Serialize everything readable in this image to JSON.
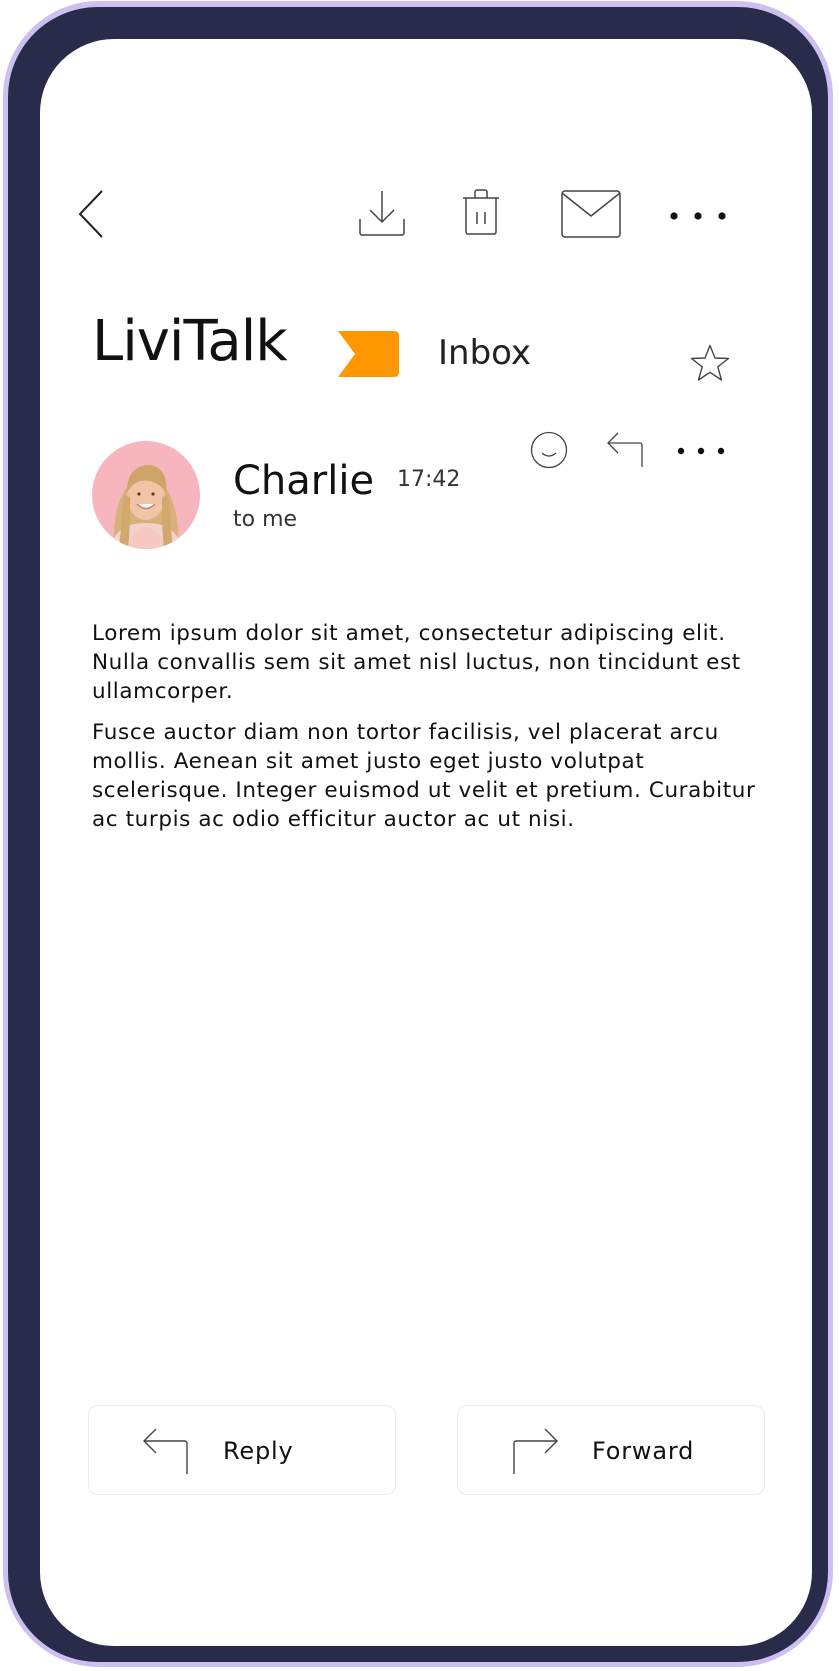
{
  "toolbar": {
    "back_icon": "chevron-left-icon",
    "download_icon": "download-icon",
    "delete_icon": "trash-icon",
    "mail_icon": "envelope-icon",
    "more_icon": "more-horizontal-icon"
  },
  "header": {
    "app_name": "LiviTalk",
    "label_color": "#ff9800",
    "folder": "Inbox",
    "star_icon": "star-icon"
  },
  "message": {
    "sender": "Charlie",
    "time": "17:42",
    "recipient": "to me",
    "actions": [
      "smiley-icon",
      "reply-icon",
      "more-horizontal-icon"
    ],
    "paragraphs": [
      "Lorem ipsum dolor sit amet, consectetur adipiscing elit. Nulla convallis sem sit amet nisl luctus, non tincidunt est ullamcorper.",
      "Fusce auctor diam non tortor facilisis, vel placerat arcu mollis. Aenean sit amet justo eget justo volutpat scelerisque. Integer euismod ut velit et pretium. Curabitur ac turpis ac odio efficitur auctor ac ut nisi."
    ]
  },
  "footer": {
    "reply_label": "Reply",
    "forward_label": "Forward"
  },
  "colors": {
    "frame": "#292b4a",
    "frame_glow": "#cdbff0",
    "accent": "#ff9800"
  }
}
